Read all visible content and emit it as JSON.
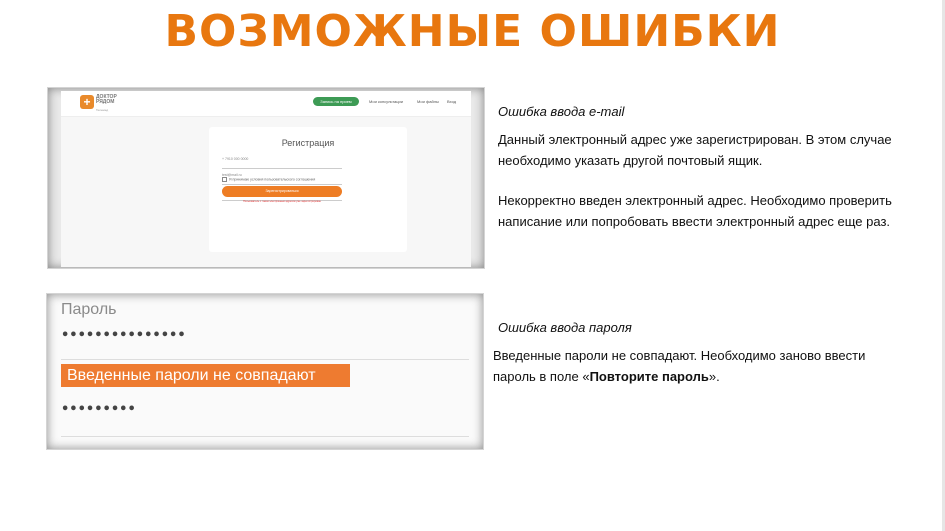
{
  "slide": {
    "title": "ВОЗМОЖНЫЕ ОШИБКИ"
  },
  "email_section": {
    "heading": "Ошибка ввода e-mail",
    "paragraph1": "Данный электронный адрес уже зарегистрирован. В этом случае необходимо указать другой почтовый ящик.",
    "paragraph2": "Некорректно введен электронный адрес. Необходимо проверить написание или попробовать ввести электронный адрес еще раз."
  },
  "password_section": {
    "heading": "Ошибка ввода пароля",
    "paragraph_before": "Введенные пароли не совпадают. Необходимо заново ввести пароль в поле «",
    "paragraph_bold": "Повторите пароль",
    "paragraph_after": "»."
  },
  "screenshot_registration": {
    "logo_text": "ДОКТОР РЯДОМ",
    "logo_sub": "Телемед",
    "header_button": "Запись на прием",
    "nav_items": [
      "Мои консультации",
      "Мои файлы",
      "Вход"
    ],
    "card_title": "Регистрация",
    "fields": [
      "+ 7910 000 0000",
      "test@mail.ru",
      "Промокод (обязательно)"
    ],
    "checkbox_label": "Я принимаю условия пользовательского соглашения",
    "submit_label": "Зарегистрироваться",
    "footnote": "Пользователь с таким электронным адресом уже зарегистрирован"
  },
  "screenshot_password": {
    "label": "Пароль",
    "password_mask": "•••••••••••••••",
    "error_text": "Введенные пароли не совпадают",
    "repeat_mask": "•••••••••"
  },
  "colors": {
    "accent": "#e8770f",
    "error_bg": "#ee7b30",
    "green": "#3d9b55"
  }
}
